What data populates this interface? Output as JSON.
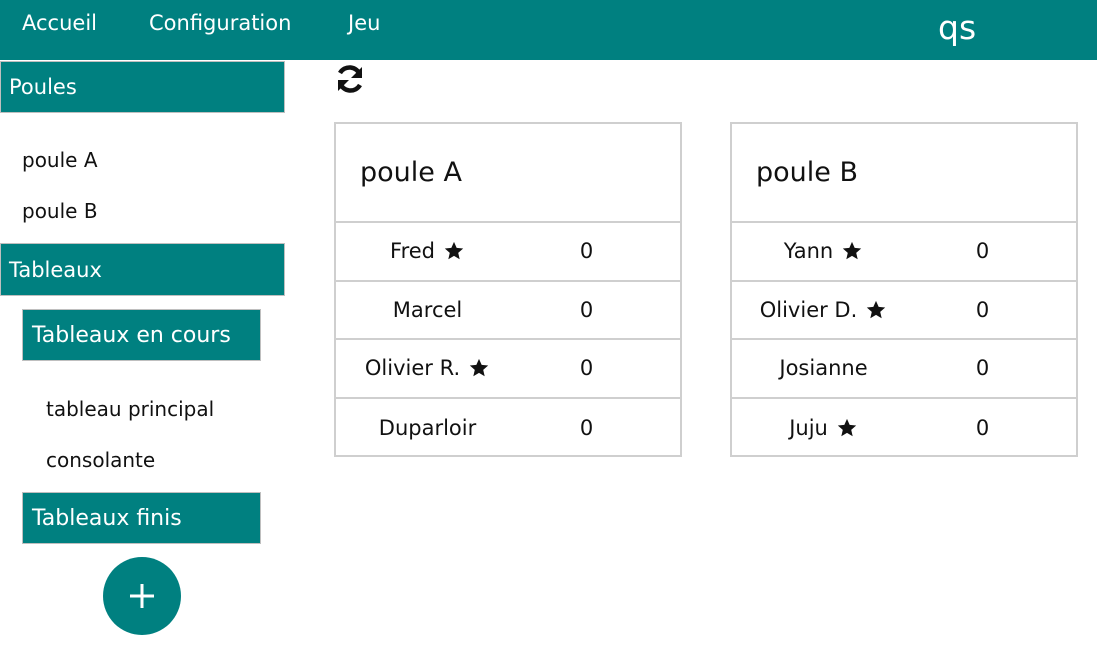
{
  "nav": {
    "items": [
      {
        "label": "Accueil"
      },
      {
        "label": "Configuration"
      },
      {
        "label": "Jeu"
      }
    ],
    "brand": "qs"
  },
  "sidebar": {
    "poules_header": "Poules",
    "poules": [
      {
        "label": "poule A"
      },
      {
        "label": "poule B"
      }
    ],
    "tableaux_header": "Tableaux",
    "en_cours_header": "Tableaux en cours",
    "en_cours_items": [
      {
        "label": "tableau principal"
      },
      {
        "label": "consolante"
      }
    ],
    "finis_header": "Tableaux finis",
    "add_label": "+"
  },
  "pools": [
    {
      "title": "poule A",
      "players": [
        {
          "name": "Fred",
          "starred": true,
          "score": "0"
        },
        {
          "name": "Marcel",
          "starred": false,
          "score": "0"
        },
        {
          "name": "Olivier R.",
          "starred": true,
          "score": "0"
        },
        {
          "name": "Duparloir",
          "starred": false,
          "score": "0"
        }
      ]
    },
    {
      "title": "poule B",
      "players": [
        {
          "name": "Yann",
          "starred": true,
          "score": "0"
        },
        {
          "name": "Olivier D.",
          "starred": true,
          "score": "0"
        },
        {
          "name": "Josianne",
          "starred": false,
          "score": "0"
        },
        {
          "name": "Juju",
          "starred": true,
          "score": "0"
        }
      ]
    }
  ],
  "colors": {
    "accent": "#008080",
    "border": "#cfcfcf"
  },
  "icons": {
    "refresh": "refresh-icon",
    "star": "star-icon",
    "add": "plus-icon"
  }
}
